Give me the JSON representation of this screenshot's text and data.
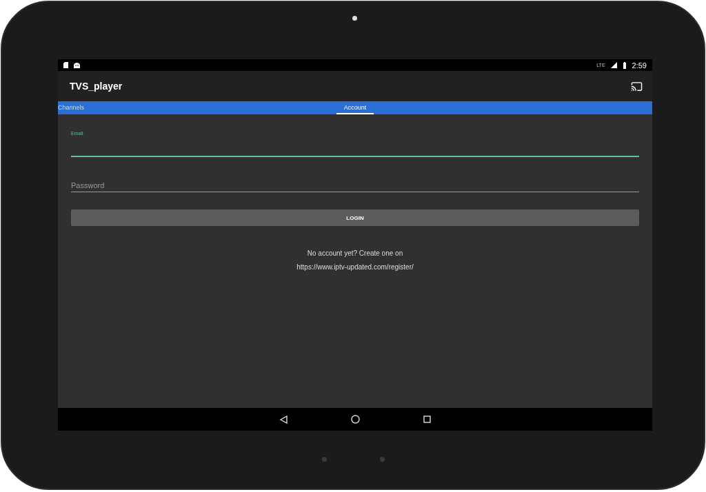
{
  "status_bar": {
    "time": "2:59",
    "network": "LTE"
  },
  "app_bar": {
    "title": "TVS_player"
  },
  "tabs": [
    {
      "label": "Channels",
      "selected": false
    },
    {
      "label": "Account",
      "selected": true
    }
  ],
  "fields": [
    {
      "label": "Email",
      "focused": true
    },
    {
      "label": "Password",
      "focused": false
    }
  ],
  "login_button": "LOGIN",
  "register_note": [
    "No account yet? Create one on",
    "https://www.iptv-updated.com/register/"
  ]
}
